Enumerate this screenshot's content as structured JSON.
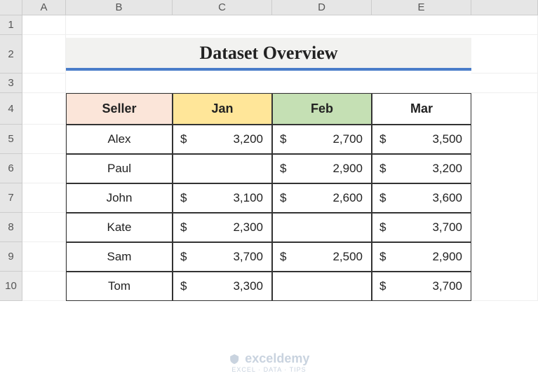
{
  "columns": [
    "A",
    "B",
    "C",
    "D",
    "E"
  ],
  "rows": [
    "1",
    "2",
    "3",
    "4",
    "5",
    "6",
    "7",
    "8",
    "9",
    "10"
  ],
  "title": "Dataset Overview",
  "headers": {
    "seller": "Seller",
    "jan": "Jan",
    "feb": "Feb",
    "mar": "Mar"
  },
  "currency_symbol": "$",
  "data": [
    {
      "seller": "Alex",
      "jan": "3,200",
      "feb": "2,700",
      "mar": "3,500"
    },
    {
      "seller": "Paul",
      "jan": "",
      "feb": "2,900",
      "mar": "3,200"
    },
    {
      "seller": "John",
      "jan": "3,100",
      "feb": "2,600",
      "mar": "3,600"
    },
    {
      "seller": "Kate",
      "jan": "2,300",
      "feb": "",
      "mar": "3,700"
    },
    {
      "seller": "Sam",
      "jan": "3,700",
      "feb": "2,500",
      "mar": "2,900"
    },
    {
      "seller": "Tom",
      "jan": "3,300",
      "feb": "",
      "mar": "3,700"
    }
  ],
  "watermark": {
    "brand": "exceldemy",
    "tagline": "EXCEL · DATA · TIPS"
  }
}
